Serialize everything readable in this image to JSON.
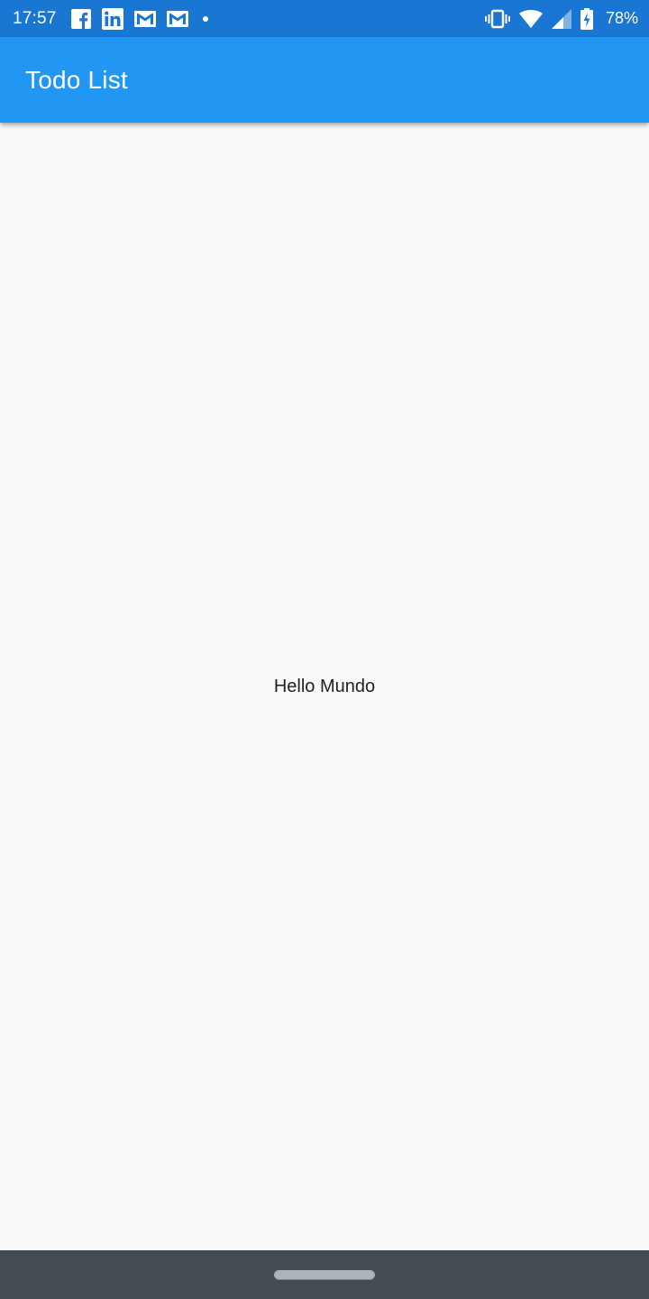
{
  "status_bar": {
    "time": "17:57",
    "battery_percent": "78%",
    "left_icons": [
      "facebook-icon",
      "linkedin-icon",
      "gmail-icon",
      "gmail-icon",
      "dot-icon"
    ],
    "right_icons": [
      "vibrate-icon",
      "wifi-icon",
      "signal-icon",
      "battery-charging-icon"
    ],
    "background_color": "#1976d2"
  },
  "app_bar": {
    "title": "Todo List",
    "background_color": "#2196f3"
  },
  "main": {
    "center_text": "Hello Mundo"
  },
  "nav_bar": {
    "background_color": "#454b52"
  }
}
